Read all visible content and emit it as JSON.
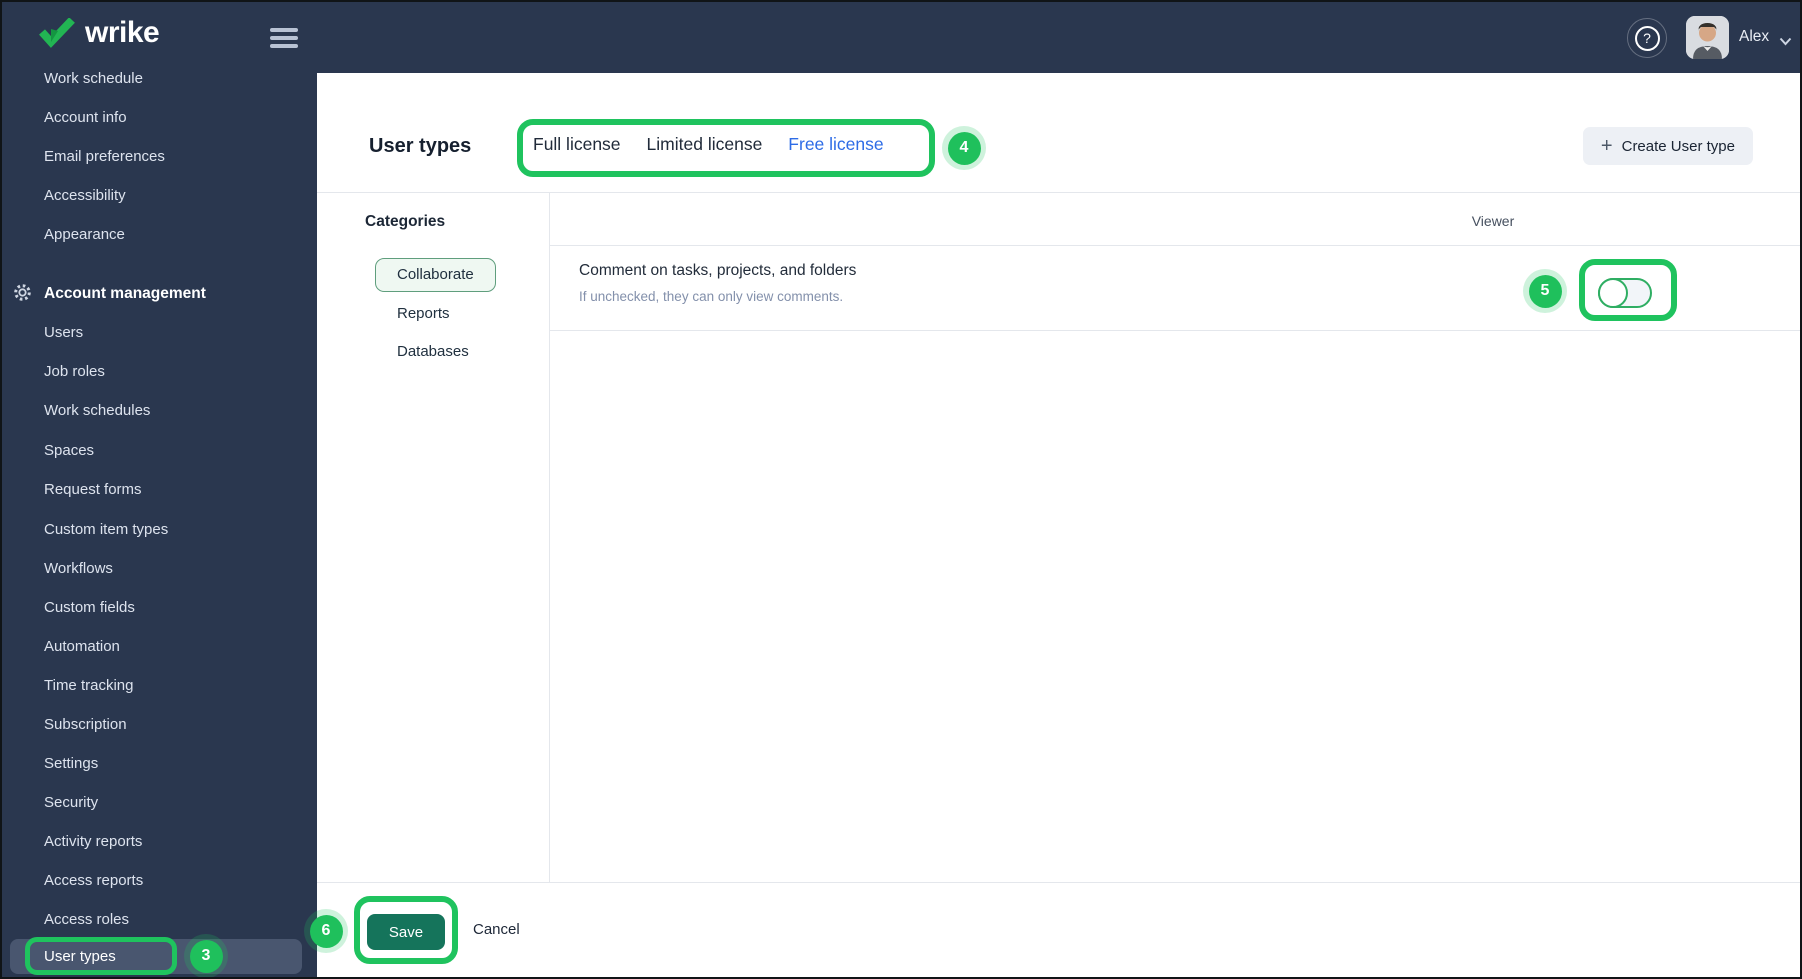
{
  "brand": {
    "logo_text": "wrike"
  },
  "topbar": {
    "user_name": "Alex"
  },
  "sidebar": {
    "items_top": [
      "Work schedule",
      "Account info",
      "Email preferences",
      "Accessibility",
      "Appearance"
    ],
    "section_label": "Account management",
    "items": [
      "Users",
      "Job roles",
      "Work schedules",
      "Spaces",
      "Request forms",
      "Custom item types",
      "Workflows",
      "Custom fields",
      "Automation",
      "Time tracking",
      "Subscription",
      "Settings",
      "Security",
      "Activity reports",
      "Access reports",
      "Access roles"
    ],
    "selected_item": "User types"
  },
  "header": {
    "title": "User types",
    "tabs": [
      {
        "label": "Full license",
        "active": false
      },
      {
        "label": "Limited license",
        "active": false
      },
      {
        "label": "Free license",
        "active": true
      }
    ],
    "create_button_label": "Create User type",
    "plus_glyph": "+"
  },
  "categories": {
    "heading": "Categories",
    "selected": "Collaborate",
    "items": [
      "Reports",
      "Databases"
    ]
  },
  "permissions_table": {
    "column_header": "Viewer",
    "rows": [
      {
        "title": "Comment on tasks, projects, and folders",
        "subtitle": "If unchecked, they can only view comments.",
        "toggle_state": "off"
      }
    ]
  },
  "footer": {
    "save_label": "Save",
    "cancel_label": "Cancel"
  },
  "annotations": {
    "step3": "3",
    "step4": "4",
    "step5": "5",
    "step6": "6"
  },
  "help_glyph": "?",
  "colors": {
    "chrome_bg": "#2a374f",
    "annotation_green": "#1fc35e",
    "save_green": "#15745b",
    "active_tab_blue": "#2e6ce6",
    "selected_sidebar_row": "#49566f",
    "category_pill_border": "#5f9e7d",
    "category_pill_bg": "#eff8f2"
  }
}
